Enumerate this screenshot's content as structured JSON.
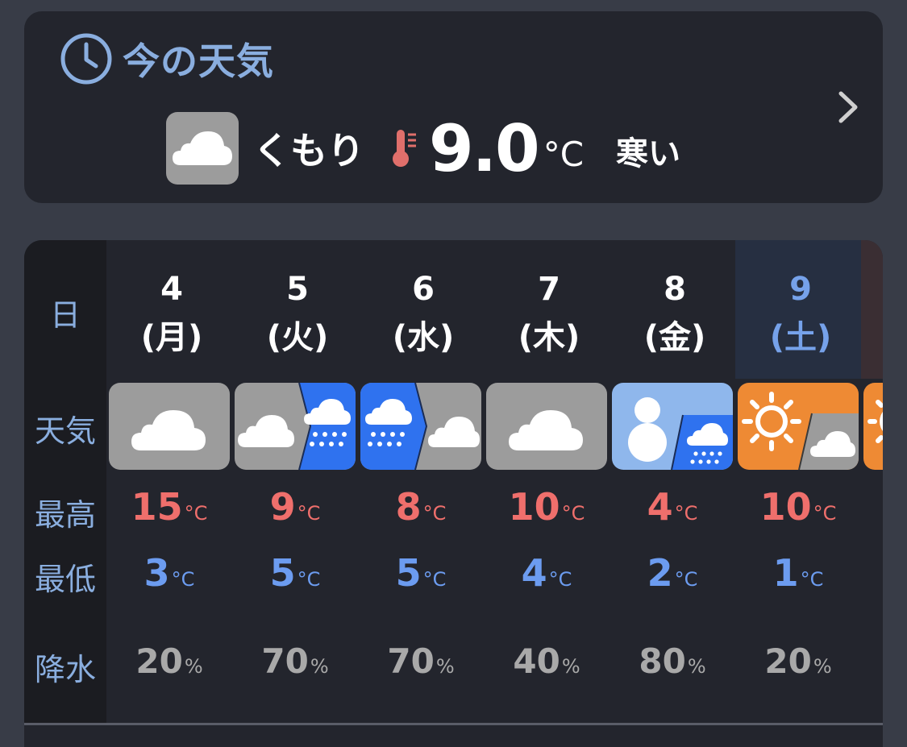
{
  "now": {
    "title": "今の天気",
    "condition": "くもり",
    "temperature": "9.0",
    "unit": "°C",
    "feel": "寒い",
    "icons": {
      "header": "clock-icon",
      "condition": "cloud-icon",
      "thermo": "thermometer-icon",
      "more": "chevron-right-icon"
    }
  },
  "week": {
    "labels": {
      "day": "日",
      "weather": "天気",
      "high": "最高",
      "low": "最低",
      "precip": "降水"
    },
    "days": [
      {
        "date": "4",
        "weekday": "(月)",
        "weather": "cloudy",
        "high": "15",
        "low": "3",
        "precip": "20"
      },
      {
        "date": "5",
        "weekday": "(火)",
        "weather": "cloudy-then-rain",
        "high": "9",
        "low": "5",
        "precip": "70"
      },
      {
        "date": "6",
        "weekday": "(水)",
        "weather": "rain-then-cloudy",
        "high": "8",
        "low": "5",
        "precip": "70"
      },
      {
        "date": "7",
        "weekday": "(木)",
        "weather": "cloudy",
        "high": "10",
        "low": "4",
        "precip": "40"
      },
      {
        "date": "8",
        "weekday": "(金)",
        "weather": "snow-then-rain",
        "high": "4",
        "low": "2",
        "precip": "80"
      },
      {
        "date": "9",
        "weekday": "(土)",
        "weather": "sunny-then-cloudy",
        "high": "10",
        "low": "1",
        "precip": "20"
      }
    ],
    "temp_unit": "°C",
    "pct_unit": "%"
  },
  "colors": {
    "high": "#ef6f6c",
    "low": "#6c9cf0",
    "accent": "#8aaedf",
    "cloudy": "#9c9c9c",
    "rain": "#2f72ef",
    "snow": "#8fb7ec",
    "sunny": "#ee8a34",
    "saturday_bg": "#262f41"
  }
}
